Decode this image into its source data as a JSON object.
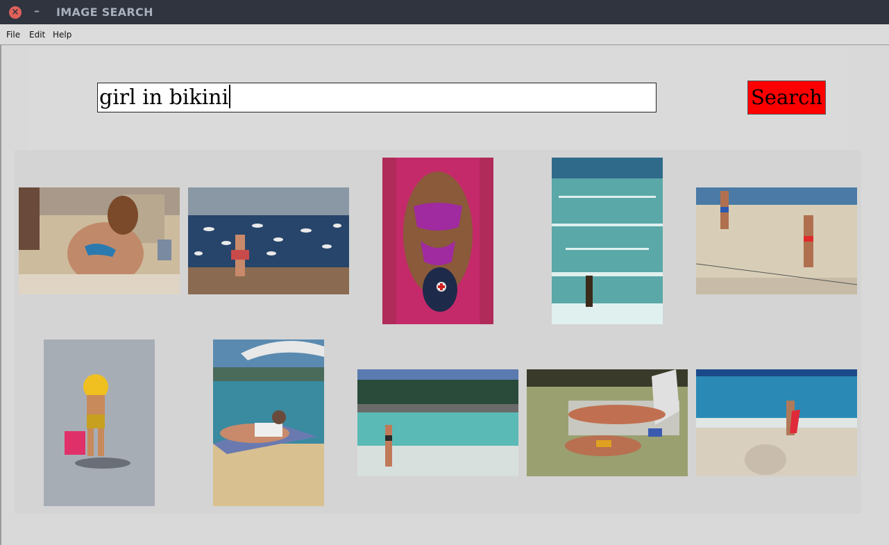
{
  "window": {
    "title": "IMAGE SEARCH"
  },
  "menu": {
    "items": [
      "File",
      "Edit",
      "Help"
    ]
  },
  "search": {
    "query": "girl in bikini",
    "button_label": "Search"
  },
  "colors": {
    "search_button": "#ff0000",
    "titlebar": "#2f343f",
    "background": "#d9d9d9"
  },
  "results": [
    {
      "description": "woman in blue bikini lying on sandy beach"
    },
    {
      "description": "woman walking on beach among seagulls"
    },
    {
      "description": "woman in purple swimsuit lying on red towel"
    },
    {
      "description": "woman standing in turquoise surf"
    },
    {
      "description": "people on beach near volleyball net"
    },
    {
      "description": "child with yellow hat and pink bucket"
    },
    {
      "description": "woman sunbathing under umbrella"
    },
    {
      "description": "woman wading in sea near palm trees"
    },
    {
      "description": "couple lounging on beach chair at shoreline"
    },
    {
      "description": "woman with red surfboard on beach"
    }
  ]
}
